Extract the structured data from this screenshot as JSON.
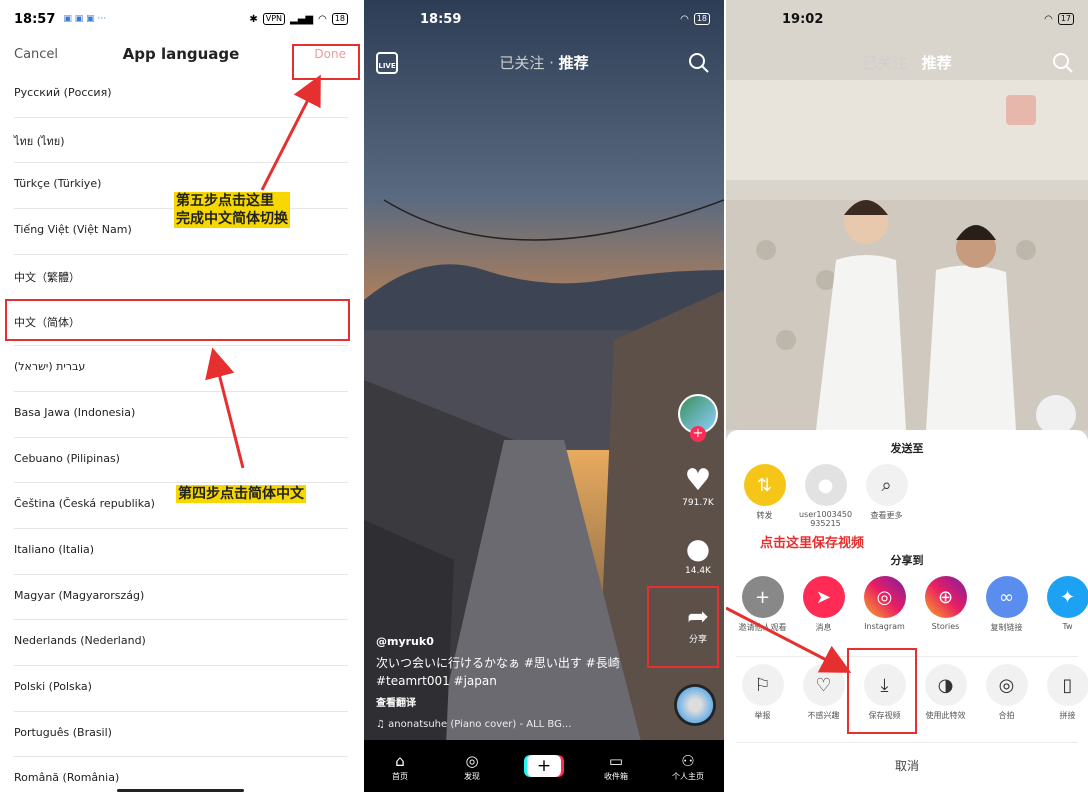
{
  "panel1": {
    "status_time": "18:57",
    "status_icons": "VPN",
    "battery": "18",
    "header": {
      "cancel": "Cancel",
      "title": "App language",
      "done": "Done"
    },
    "languages": [
      "Русский (Россия)",
      "ไทย (ไทย)",
      "Türkçe (Türkiye)",
      "Tiếng Việt (Việt Nam)",
      "中文（繁體）",
      "中文（简体）",
      "עברית (ישראל)",
      "Basa Jawa (Indonesia)",
      "Cebuano (Pilipinas)",
      "Čeština (Česká republika)",
      "Italiano (Italia)",
      "Magyar (Magyarország)",
      "Nederlands (Nederland)",
      "Polski (Polska)",
      "Português (Brasil)",
      "Română (România)"
    ],
    "annotation_step5": [
      "第五步点击这里",
      "完成中文简体切换"
    ],
    "annotation_step4": "第四步点击简体中文",
    "accent_red": "#e63030",
    "annotation_bg": "#f6d800"
  },
  "panel2": {
    "status_time": "18:59",
    "battery": "18",
    "live": "LIVE",
    "tab_following": "已关注",
    "tab_separator": "·",
    "tab_recommend": "推荐",
    "likes": "791.7K",
    "comments": "14.4K",
    "share": "分享",
    "username": "@myruk0",
    "caption": "次いつ会いに行けるかなぁ #思い出す #長崎 #teamrt001 #japan",
    "translate": "查看翻译",
    "music": "anonatsuhe (Piano cover) - ALL BG...",
    "nav": {
      "home": "首页",
      "discover": "发现",
      "inbox": "收件箱",
      "profile": "个人主页"
    }
  },
  "panel3": {
    "status_time": "19:02",
    "battery": "17",
    "tab_following": "已关注",
    "tab_separator": "·",
    "tab_recommend": "推荐",
    "send_to": "发送至",
    "send_row": [
      {
        "label": "转发",
        "icon": "repost-icon"
      },
      {
        "label": "user1003450\n935215",
        "icon": "user-avatar-icon"
      },
      {
        "label": "查看更多",
        "icon": "search-icon"
      }
    ],
    "annotation_save": "点击这里保存视频",
    "share_to": "分享到",
    "share_row": [
      {
        "label": "邀请他人观看",
        "icon": "invite-icon"
      },
      {
        "label": "消息",
        "icon": "message-icon"
      },
      {
        "label": "Instagram",
        "icon": "instagram-icon"
      },
      {
        "label": "Stories",
        "icon": "stories-icon"
      },
      {
        "label": "复制链接",
        "icon": "link-icon"
      },
      {
        "label": "Tw",
        "icon": "twitter-icon"
      }
    ],
    "action_row": [
      {
        "label": "举报",
        "icon": "flag-icon"
      },
      {
        "label": "不感兴趣",
        "icon": "broken-heart-icon"
      },
      {
        "label": "保存视频",
        "icon": "download-icon"
      },
      {
        "label": "使用此特效",
        "icon": "mask-icon"
      },
      {
        "label": "合拍",
        "icon": "duet-icon"
      },
      {
        "label": "拼接",
        "icon": "stitch-icon"
      }
    ],
    "cancel": "取消"
  }
}
